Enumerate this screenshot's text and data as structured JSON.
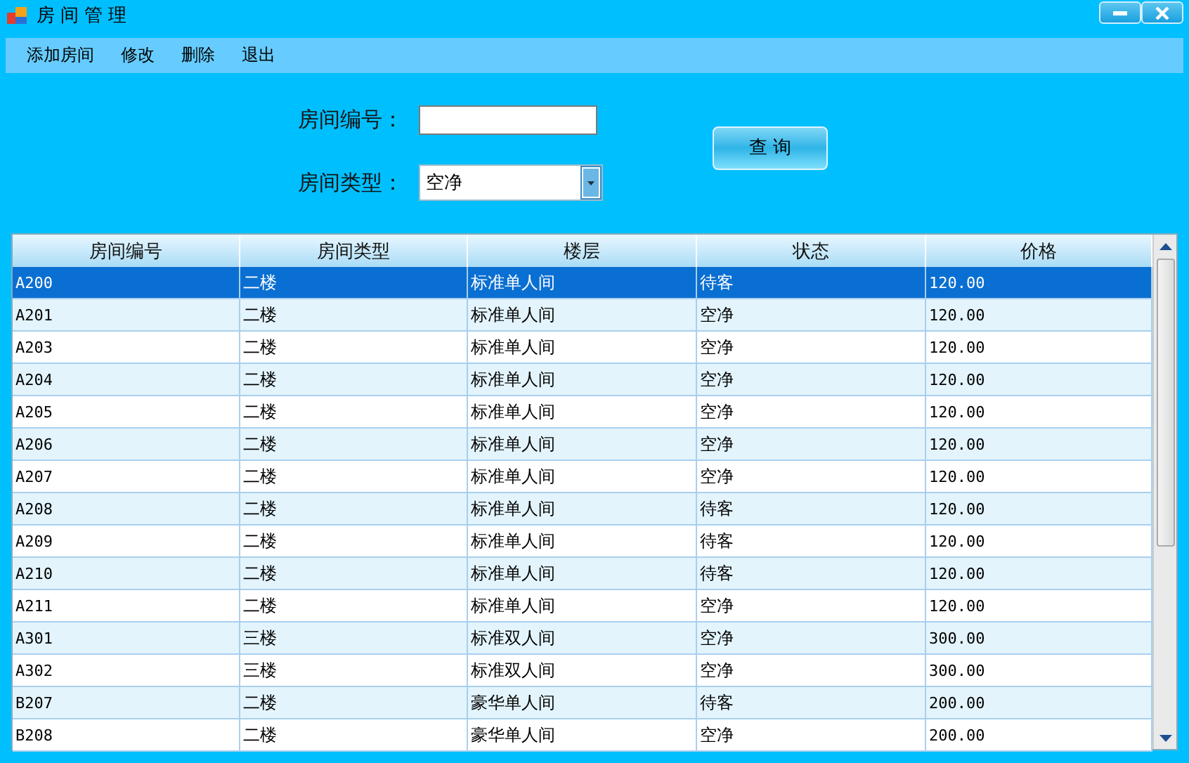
{
  "window": {
    "title": "房间管理"
  },
  "menu": [
    "添加房间",
    "修改",
    "删除",
    "退出"
  ],
  "form": {
    "room_no": {
      "label": "房间编号："
    },
    "room_type": {
      "label": "房间类型：",
      "value": "空净"
    },
    "search_button": "查 询"
  },
  "table": {
    "columns": [
      "房间编号",
      "房间类型",
      "楼层",
      "状态",
      "价格"
    ],
    "rows": [
      {
        "cells": [
          "A200",
          "二楼",
          "标准单人间",
          "待客",
          "120.00"
        ],
        "selected": true
      },
      {
        "cells": [
          "A201",
          "二楼",
          "标准单人间",
          "空净",
          "120.00"
        ],
        "selected": false
      },
      {
        "cells": [
          "A203",
          "二楼",
          "标准单人间",
          "空净",
          "120.00"
        ],
        "selected": false
      },
      {
        "cells": [
          "A204",
          "二楼",
          "标准单人间",
          "空净",
          "120.00"
        ],
        "selected": false
      },
      {
        "cells": [
          "A205",
          "二楼",
          "标准单人间",
          "空净",
          "120.00"
        ],
        "selected": false
      },
      {
        "cells": [
          "A206",
          "二楼",
          "标准单人间",
          "空净",
          "120.00"
        ],
        "selected": false
      },
      {
        "cells": [
          "A207",
          "二楼",
          "标准单人间",
          "空净",
          "120.00"
        ],
        "selected": false
      },
      {
        "cells": [
          "A208",
          "二楼",
          "标准单人间",
          "待客",
          "120.00"
        ],
        "selected": false
      },
      {
        "cells": [
          "A209",
          "二楼",
          "标准单人间",
          "待客",
          "120.00"
        ],
        "selected": false
      },
      {
        "cells": [
          "A210",
          "二楼",
          "标准单人间",
          "待客",
          "120.00"
        ],
        "selected": false
      },
      {
        "cells": [
          "A211",
          "二楼",
          "标准单人间",
          "空净",
          "120.00"
        ],
        "selected": false
      },
      {
        "cells": [
          "A301",
          "三楼",
          "标准双人间",
          "空净",
          "300.00"
        ],
        "selected": false
      },
      {
        "cells": [
          "A302",
          "三楼",
          "标准双人间",
          "空净",
          "300.00"
        ],
        "selected": false
      },
      {
        "cells": [
          "B207",
          "二楼",
          "豪华单人间",
          "待客",
          "200.00"
        ],
        "selected": false
      },
      {
        "cells": [
          "B208",
          "二楼",
          "豪华单人间",
          "空净",
          "200.00"
        ],
        "selected": false
      }
    ]
  }
}
